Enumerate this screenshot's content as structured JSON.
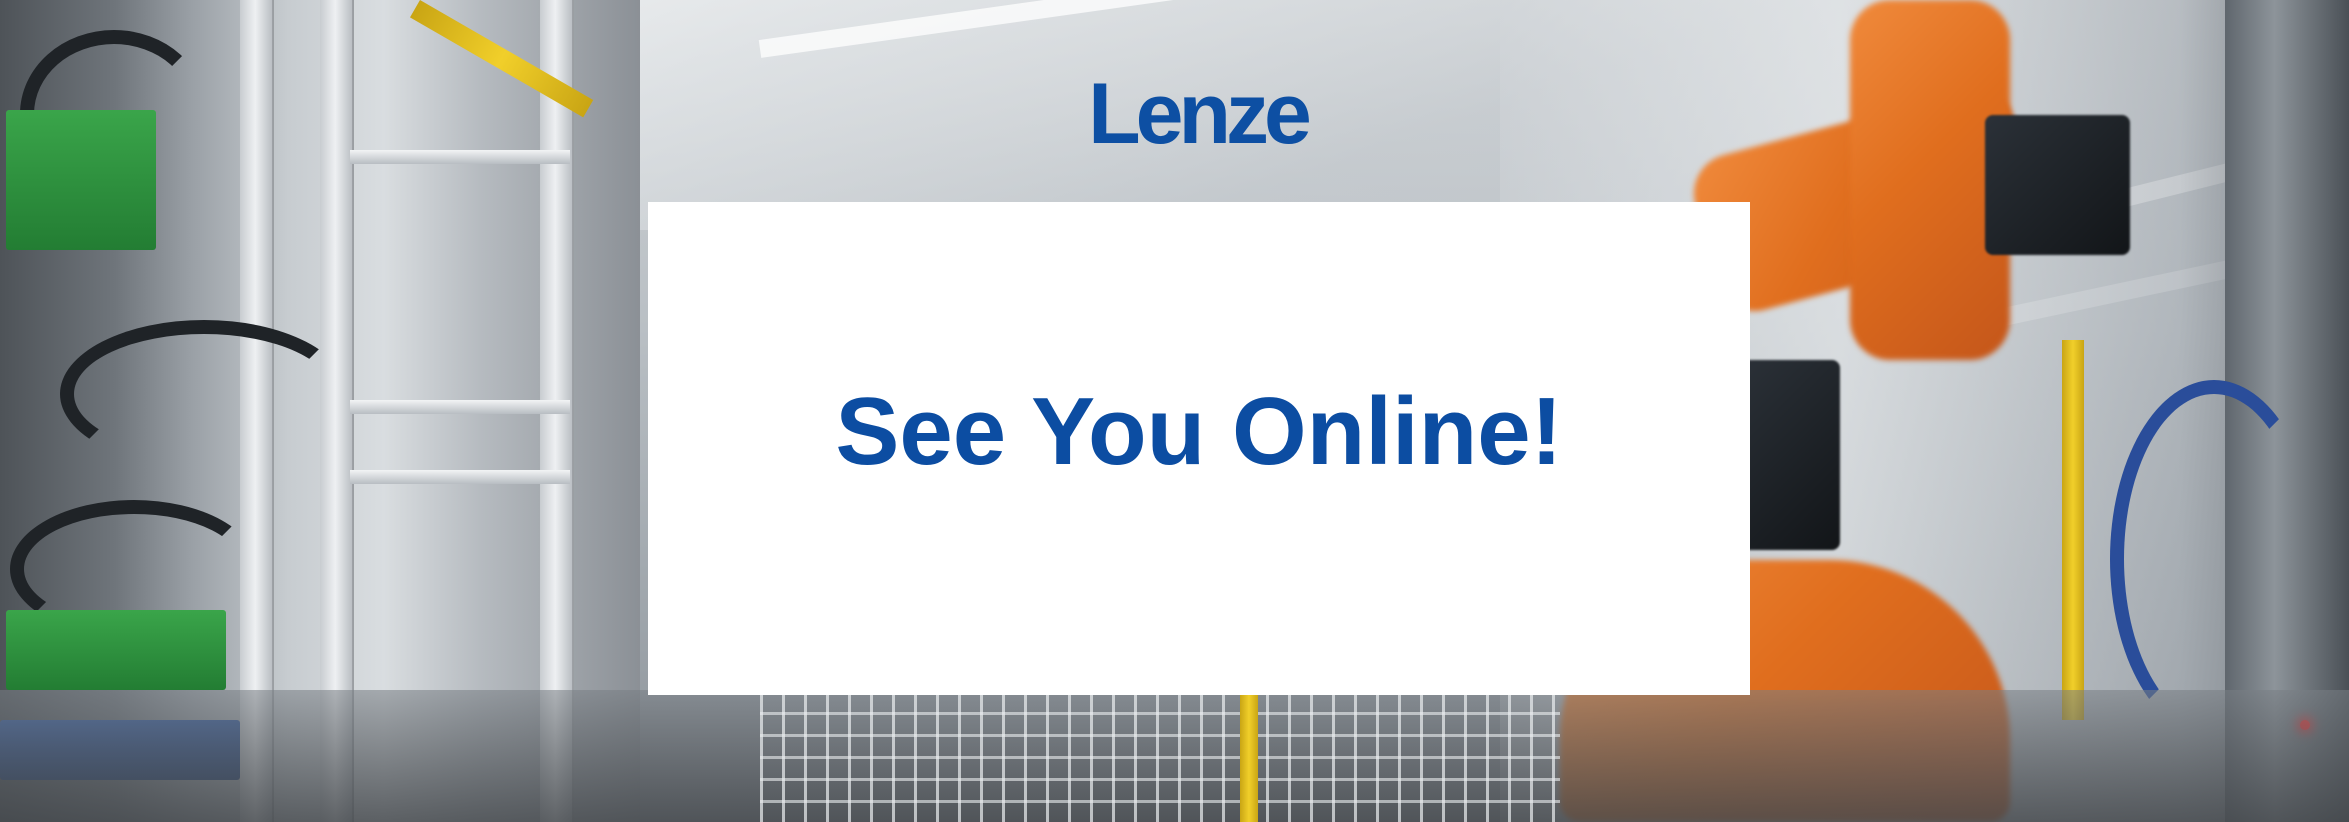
{
  "brand": {
    "logo_text": "Lenze",
    "brand_color": "#0c4da2"
  },
  "card": {
    "headline": "See You Online!"
  },
  "background": {
    "description_tag": "industrial-factory-robot-photo",
    "accent_colors": {
      "robot_orange": "#e06e1e",
      "safety_yellow": "#f1cf2a",
      "rack_green": "#2f9640"
    }
  }
}
